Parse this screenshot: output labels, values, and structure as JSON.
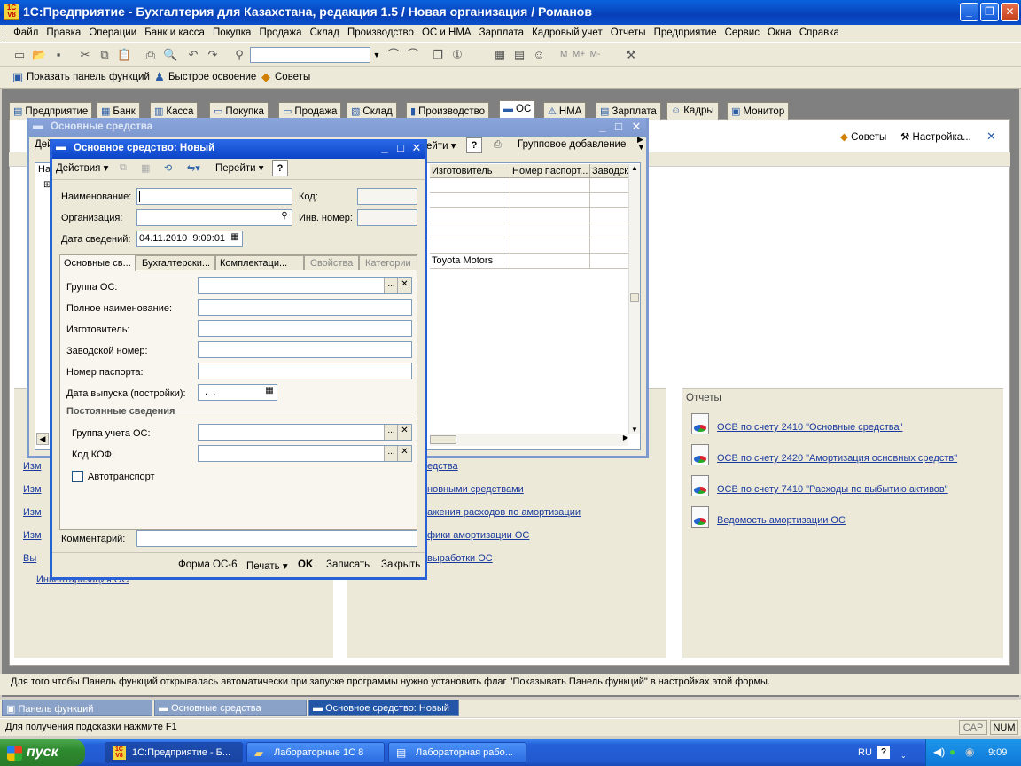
{
  "app": {
    "title": "1С:Предприятие - Бухгалтерия для Казахстана, редакция 1.5 / Новая организация / Романов",
    "logo_text": "1C V8"
  },
  "menu": [
    "Файл",
    "Правка",
    "Операции",
    "Банк и касса",
    "Покупка",
    "Продажа",
    "Склад",
    "Производство",
    "ОС и НМА",
    "Зарплата",
    "Кадровый учет",
    "Отчеты",
    "Предприятие",
    "Сервис",
    "Окна",
    "Справка"
  ],
  "toolbar2": {
    "functions_panel": "Показать панель функций",
    "quick_start": "Быстрое освоение",
    "tips": "Советы"
  },
  "tabs": [
    "Предприятие",
    "Банк",
    "Касса",
    "Покупка",
    "Продажа",
    "Склад",
    "Производство",
    "ОС",
    "НМА",
    "Зарплата",
    "Кадры",
    "Монитор"
  ],
  "panel": {
    "tips": "Советы",
    "settings": "Настройка...",
    "reports_title": "Отчеты",
    "reports": [
      "ОСВ по счету 2410 \"Основные средства\"",
      "ОСВ по счету 2420 \"Амортизация основных средств\"",
      "ОСВ по счету 7410 \"Расходы по выбытию активов\"",
      "Ведомость амортизации ОС"
    ],
    "left_links": [
      "Изм",
      "Изм",
      "Изм",
      "Изм",
      "Вы",
      "Инвентаризация ОС"
    ],
    "mid_links": [
      "едства",
      "новными средствами",
      "ажения расходов по амортизации",
      "фики амортизации ОС",
      "выработки ОС"
    ],
    "hint": "Для того чтобы Панель функций открывалась автоматически при запуске программы нужно установить флаг \"Показывать Панель функций\" в настройках этой формы."
  },
  "list_window": {
    "title": "Основные средства",
    "actions_partial": "Дей",
    "goto_partial": "ейти",
    "group_add": "Групповое добавление",
    "col_partial": "На",
    "columns": [
      "Изготовитель",
      "Номер паспорт...",
      "Заводск"
    ],
    "rows": [
      "",
      "",
      "",
      "",
      "",
      "Toyota Motors"
    ]
  },
  "form": {
    "title": "Основное средство: Новый",
    "actions": "Действия",
    "goto": "Перейти",
    "name_label": "Наименование:",
    "name_value": "",
    "code_label": "Код:",
    "code_value": "",
    "org_label": "Организация:",
    "org_value": "",
    "inv_label": "Инв. номер:",
    "inv_value": "",
    "date_label": "Дата сведений:",
    "date_value": "04.11.2010  9:09:01",
    "tabs": [
      "Основные св...",
      "Бухгалтерски...",
      "Комплектаци...",
      "Свойства",
      "Категории"
    ],
    "group_label": "Группа ОС:",
    "fullname_label": "Полное наименование:",
    "maker_label": "Изготовитель:",
    "serial_label": "Заводской номер:",
    "passport_label": "Номер паспорта:",
    "release_label": "Дата выпуска (постройки):",
    "release_value": " .  .",
    "const_title": "Постоянные сведения",
    "acc_group_label": "Группа учета ОС:",
    "kof_label": "Код КОФ:",
    "vehicle_label": "Автотранспорт",
    "comment_label": "Комментарий:",
    "comment_value": "",
    "buttons": {
      "form_os6": "Форма ОС-6",
      "print": "Печать",
      "ok": "OK",
      "save": "Записать",
      "close": "Закрыть"
    }
  },
  "window_tabs": [
    "Панель функций",
    "Основные средства",
    "Основное средство: Новый"
  ],
  "status": {
    "hint": "Для получения подсказки нажмите F1",
    "cap": "CAP",
    "num": "NUM"
  },
  "taskbar": {
    "start": "пуск",
    "items": [
      "1С:Предприятие - Б...",
      "Лабораторные 1С 8",
      "Лабораторная рабо..."
    ],
    "lang": "RU",
    "time": "9:09"
  }
}
